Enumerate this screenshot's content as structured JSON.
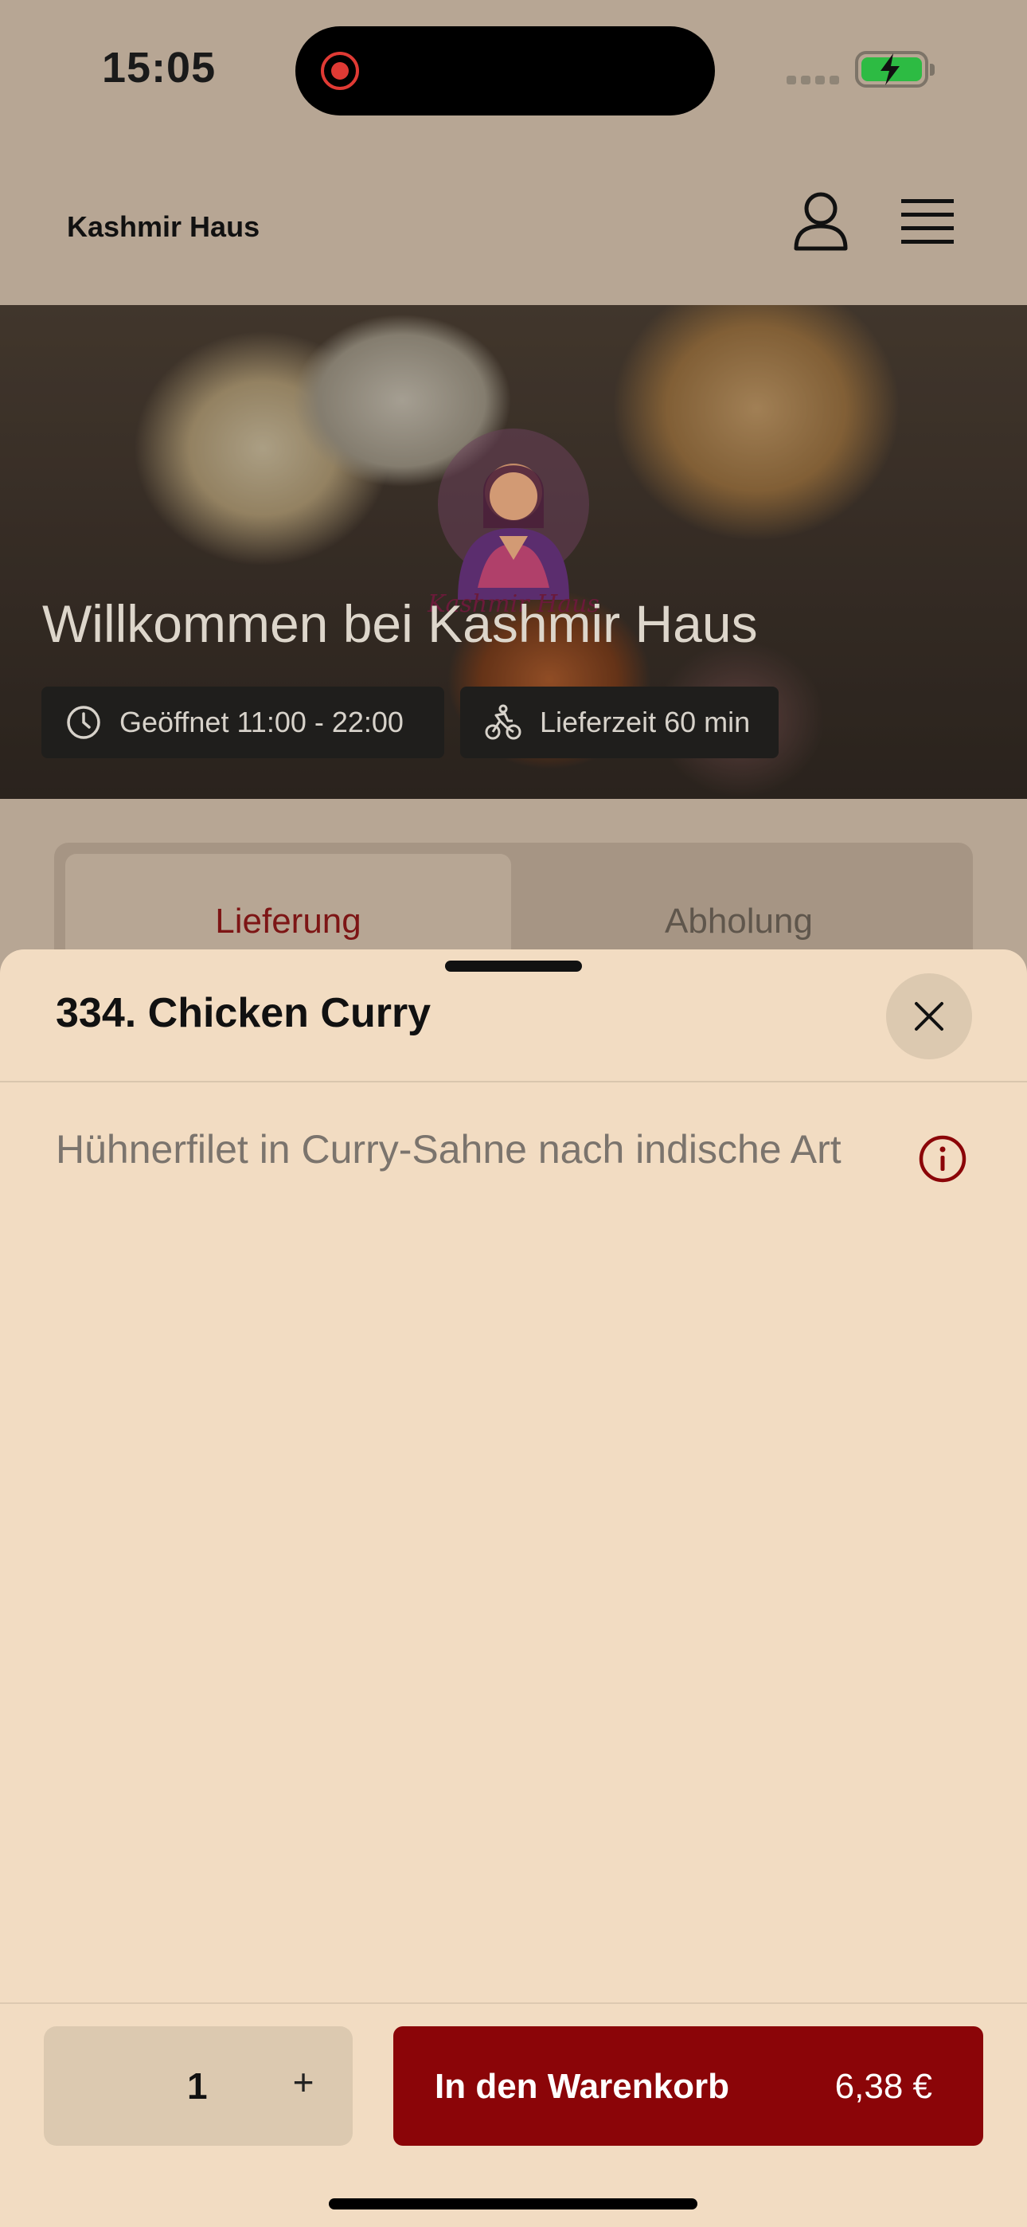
{
  "status_bar": {
    "time": "15:05"
  },
  "header": {
    "brand": "Kashmir Haus"
  },
  "hero": {
    "title": "Willkommen bei Kashmir Haus",
    "logo_text": "Kashmir Haus",
    "opening_hours": "Geöffnet 11:00 - 22:00",
    "delivery_time": "Lieferzeit 60 min"
  },
  "mode_tabs": {
    "delivery": "Lieferung",
    "pickup": "Abholung",
    "selected": "Lieferung"
  },
  "sheet": {
    "title": "334. Chicken Curry",
    "description": "Hühnerfilet in Curry-Sahne nach indische Art",
    "quantity": "1",
    "plus": "+",
    "add_to_cart": "In den Warenkorb",
    "price": "6,38 €"
  },
  "colors": {
    "accent": "#8b0508",
    "sheet_bg": "#f2dcc2",
    "battery": "#2dbb43"
  },
  "icons": [
    "record-icon",
    "battery-icon",
    "profile-icon",
    "menu-icon",
    "clock-icon",
    "bike-icon",
    "close-icon",
    "info-icon"
  ]
}
